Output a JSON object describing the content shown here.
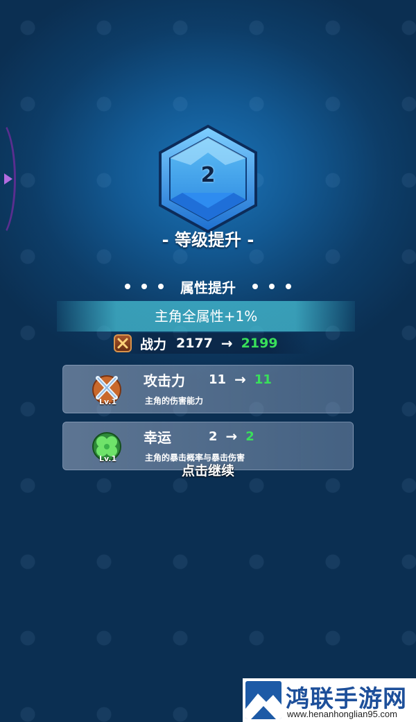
{
  "gem": {
    "level": "2"
  },
  "level_up_title": "- 等级提升 -",
  "attributes": {
    "title": "属性提升",
    "bonus": "主角全属性+1%"
  },
  "power": {
    "label": "战力",
    "old": "2177",
    "arrow": "→",
    "new": "2199"
  },
  "cards": [
    {
      "name": "攻击力",
      "old": "11",
      "arrow": "→",
      "new": "11",
      "desc": "主角的伤害能力",
      "lv": "Lv.1",
      "icon": "crossed-swords-icon"
    },
    {
      "name": "幸运",
      "old": "2",
      "arrow": "→",
      "new": "2",
      "desc": "主角的暴击概率与暴击伤害",
      "lv": "Lv.1",
      "icon": "clover-icon"
    }
  ],
  "tap_continue": "点击继续",
  "watermark": {
    "title": "鸿联手游网",
    "url": "www.henanhonglian95.com"
  },
  "colors": {
    "increase_green": "#39e05a",
    "background_blue": "#135a94",
    "gem_blue": "#2f9df0"
  }
}
